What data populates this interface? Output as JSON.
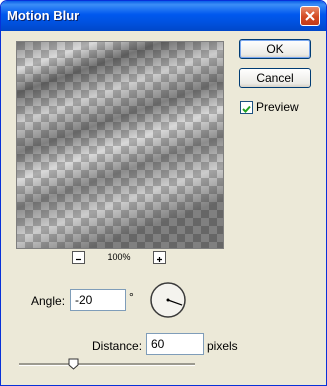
{
  "window": {
    "title": "Motion Blur"
  },
  "buttons": {
    "ok_label": "OK",
    "cancel_label": "Cancel"
  },
  "preview": {
    "checkbox_label": "Preview",
    "checked": true,
    "zoom": "100%"
  },
  "angle": {
    "label": "Angle:",
    "value": "-20",
    "unit": "°"
  },
  "distance": {
    "label": "Distance:",
    "value": "60",
    "unit": "pixels",
    "slider_fraction": 0.31
  },
  "colors": {
    "title_bar": "#0054e3",
    "dialog_bg": "#ece9d8",
    "close_button": "#d34a22"
  },
  "icons": {
    "zoom_out": "minus-icon",
    "zoom_in": "plus-icon",
    "close": "close-icon",
    "check": "checkmark-icon"
  }
}
